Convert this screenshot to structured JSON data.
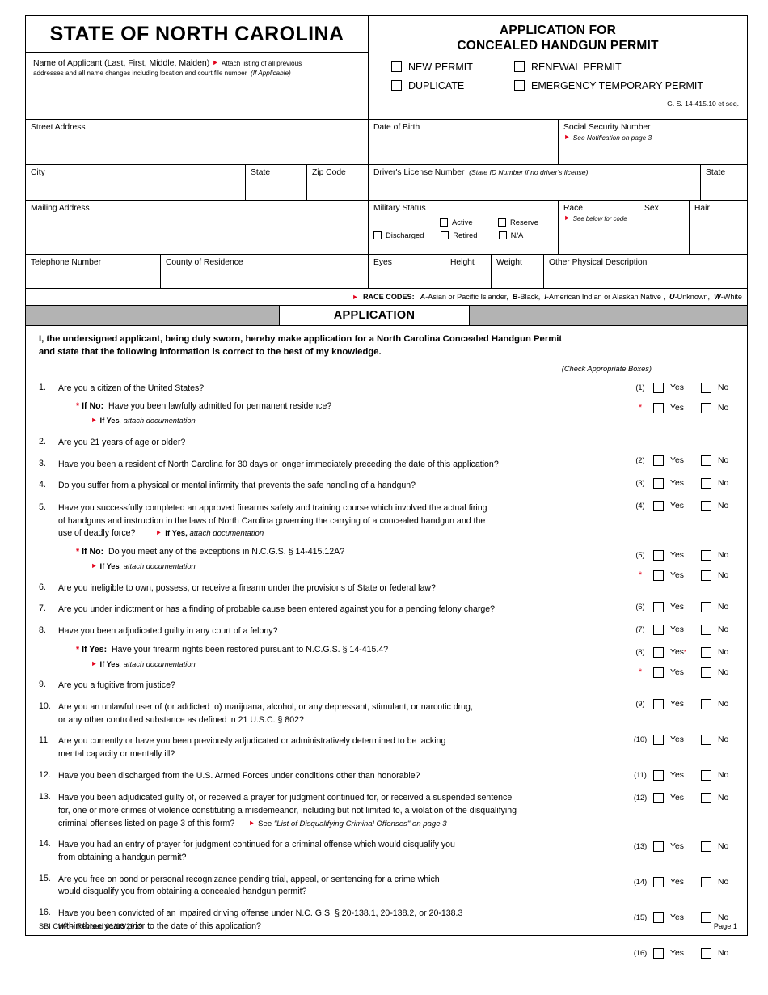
{
  "header": {
    "state_title": "STATE OF NORTH CAROLINA",
    "name_label": "Name of Applicant   (Last, First, Middle, Maiden)",
    "name_note_1": "Attach listing of all previous",
    "name_note_2": "addresses and all name changes including location and court file number",
    "name_note_2_italic": "(If Applicable)",
    "app_title_line1": "APPLICATION FOR",
    "app_title_line2": "CONCEALED HANDGUN PERMIT",
    "permit_options": [
      "NEW PERMIT",
      "RENEWAL PERMIT",
      "DUPLICATE",
      "EMERGENCY TEMPORARY PERMIT"
    ],
    "statute_note": "G. S. 14-415.10 et seq."
  },
  "info_fields": {
    "street_address": "Street Address",
    "date_of_birth": "Date of Birth",
    "ssn": "Social Security Number",
    "ssn_note": "See Notification on page 3",
    "city": "City",
    "state": "State",
    "zip_code": "Zip Code",
    "dl_number": "Driver's License Number",
    "dl_note": "(State ID Number if no driver's license)",
    "dl_state": "State",
    "mailing_address": "Mailing Address",
    "military_status": "Military Status",
    "military_options": [
      "Active",
      "Reserve",
      "Discharged",
      "Retired",
      "N/A"
    ],
    "race": "Race",
    "race_note": "See below for code",
    "sex": "Sex",
    "hair": "Hair",
    "telephone": "Telephone Number",
    "county": "County of Residence",
    "eyes": "Eyes",
    "height": "Height",
    "weight": "Weight",
    "other_physical": "Other Physical Description"
  },
  "race_codes": {
    "label": "RACE CODES:",
    "codes": [
      {
        "letter": "A",
        "desc": "-Asian or Pacific Islander,"
      },
      {
        "letter": "B",
        "desc": "-Black,"
      },
      {
        "letter": "I",
        "desc": "-American Indian or Alaskan Native ,"
      },
      {
        "letter": "U",
        "desc": "-Unknown,"
      },
      {
        "letter": "W",
        "desc": "-White"
      }
    ]
  },
  "application_band": {
    "title": "APPLICATION"
  },
  "sworn_statement": {
    "line1": "I, the undersigned applicant, being duly sworn, hereby make application for a North Carolina Concealed Handgun Permit",
    "line2": "and state that the following information is correct to the best of my knowledge.",
    "check_note": "(Check Appropriate Boxes)"
  },
  "answer_labels": {
    "yes": "Yes",
    "no": "No"
  },
  "questions": [
    {
      "num": "1.",
      "ref": "(1)",
      "text": "Are you a citizen of the United States?",
      "sub_prefix": "If No:",
      "sub_text": "Have you been lawfully admitted for permanent residence?",
      "sub_note_bold": "If Yes",
      "sub_note_rest": ", attach documentation"
    },
    {
      "num": "2.",
      "ref": "(2)",
      "text": "Are you 21 years of age or older?"
    },
    {
      "num": "3.",
      "ref": "(3)",
      "text": "Have you been a resident of North Carolina for 30 days or longer immediately preceding the date of this application?"
    },
    {
      "num": "4.",
      "ref": "(4)",
      "text": "Do you suffer from a physical or mental infirmity that prevents the safe handling of a handgun?"
    },
    {
      "num": "5.",
      "ref": "(5)",
      "text_l1": "Have you successfully completed an approved firearms safety and training course which involved the actual firing",
      "text_l2": "of handguns and instruction in the laws of North Carolina governing the carrying of a concealed handgun and the",
      "text_l3": "use of deadly force?",
      "inline_bold": "If Yes,",
      "inline_rest": " attach documentation",
      "sub_prefix": "If No:",
      "sub_text": "Do you meet any of the exceptions in N.C.G.S. § 14-415.12A?",
      "sub_note_bold": "If Yes",
      "sub_note_rest": ", attach documentation"
    },
    {
      "num": "6.",
      "ref": "(6)",
      "text": "Are you ineligible to own, possess, or receive a firearm under the provisions of State or federal law?"
    },
    {
      "num": "7.",
      "ref": "(7)",
      "text": "Are you under indictment or has a finding of probable cause been entered against you for a pending felony charge?"
    },
    {
      "num": "8.",
      "ref": "(8)",
      "text": "Have you been adjudicated guilty in any court of a felony?",
      "yes_has_star": true,
      "sub_prefix": "If Yes:",
      "sub_text": "Have your firearm rights been restored pursuant to N.C.G.S. § 14-415.4?",
      "sub_note_bold": "If Yes",
      "sub_note_rest": ", attach documentation"
    },
    {
      "num": "9.",
      "ref": "(9)",
      "text": "Are you a fugitive from justice?"
    },
    {
      "num": "10.",
      "ref": "(10)",
      "text_l1": "Are you an unlawful user of (or addicted to) marijuana, alcohol, or any depressant, stimulant, or narcotic drug,",
      "text_l2": "or any other controlled substance as defined in 21 U.S.C. § 802?"
    },
    {
      "num": "11.",
      "ref": "(11)",
      "text_l1": "Are you currently or have you been previously adjudicated or administratively determined to be lacking",
      "text_l2": "mental capacity or mentally ill?"
    },
    {
      "num": "12.",
      "ref": "(12)",
      "text": "Have you been discharged from the U.S. Armed Forces under conditions other than honorable?"
    },
    {
      "num": "13.",
      "ref": "(13)",
      "text_l1": "Have you  been adjudicated guilty of, or received a prayer for judgment continued for, or received a suspended sentence",
      "text_l2": "for, one or more crimes of violence constituting a misdemeanor, including but not limited to, a violation of the disqualifying",
      "text_l3": "criminal offenses listed on page 3 of this form?",
      "inline_plain": "See ",
      "inline_italic": "\"List of Disqualifying Criminal Offenses\" on page 3"
    },
    {
      "num": "14.",
      "ref": "(14)",
      "text_l1": "Have you had an entry of prayer for judgment continued for a criminal offense which would disqualify you",
      "text_l2": "from obtaining a handgun permit?"
    },
    {
      "num": "15.",
      "ref": "(15)",
      "text_l1": "Are you free on bond or personal recognizance pending trial, appeal, or sentencing for a crime which",
      "text_l2": "would disqualify you from obtaining a concealed handgun permit?"
    },
    {
      "num": "16.",
      "ref": "(16)",
      "text_l1": "Have you been convicted of an impaired driving offense under N.C. G.S. § 20-138.1, 20-138.2, or 20-138.3",
      "text_l2": "within three years prior to the date of this application?"
    }
  ],
  "footer": {
    "left": "SBI CHP – Revised 01/16/2019",
    "right": "Page 1"
  },
  "colors": {
    "accent_red": "#e2001a",
    "band_gray": "#b3b3b3",
    "border": "#000000"
  }
}
